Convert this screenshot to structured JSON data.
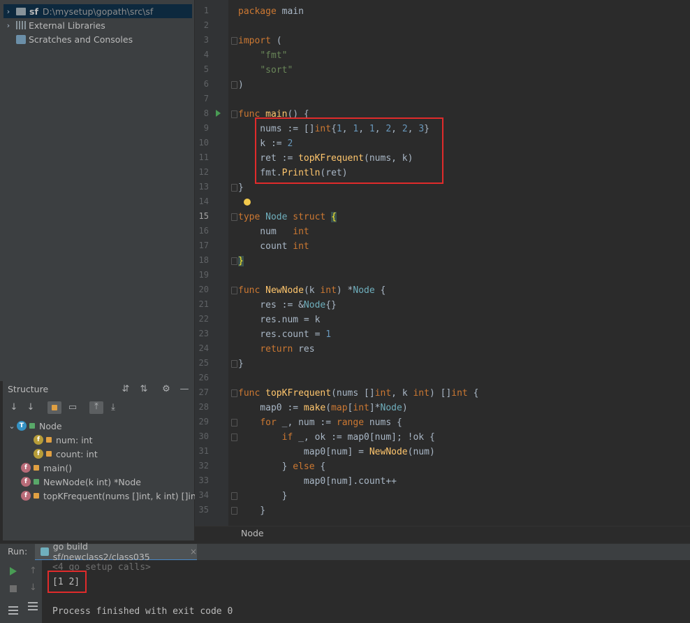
{
  "project": {
    "root_name": "sf",
    "root_path": "D:\\mysetup\\gopath\\src\\sf",
    "external_libraries": "External Libraries",
    "scratches": "Scratches and Consoles"
  },
  "structure": {
    "title": "Structure",
    "items": [
      {
        "label": "Node"
      },
      {
        "label": "num: int"
      },
      {
        "label": "count: int"
      },
      {
        "label": "main()"
      },
      {
        "label": "NewNode(k int) *Node"
      },
      {
        "label": "topKFrequent(nums []int, k int) []int"
      }
    ],
    "badges": {
      "type": "T",
      "field": "f",
      "func": "f"
    }
  },
  "editor": {
    "line_numbers": [
      "1",
      "2",
      "3",
      "4",
      "5",
      "6",
      "7",
      "8",
      "9",
      "10",
      "11",
      "12",
      "13",
      "14",
      "15",
      "16",
      "17",
      "18",
      "19",
      "20",
      "21",
      "22",
      "23",
      "24",
      "25",
      "26",
      "27",
      "28",
      "29",
      "30",
      "31",
      "32",
      "33",
      "34",
      "35"
    ],
    "current_line": "15"
  },
  "breadcrumb": {
    "label": "Node"
  },
  "run": {
    "label": "Run:",
    "tab_label": "go build sf/newclass2/class035",
    "close_icon": "×",
    "console_lines": [
      "<4 go setup calls>",
      "[1 2]",
      "",
      "Process finished with exit code 0"
    ]
  },
  "colors": {
    "editor_bg": "#2b2b2b",
    "panel_bg": "#3c3f41",
    "keyword": "#cc7832",
    "string": "#6a8759",
    "number": "#6897bb",
    "function": "#ffc66d",
    "highlight_box": "#e02b2b"
  }
}
